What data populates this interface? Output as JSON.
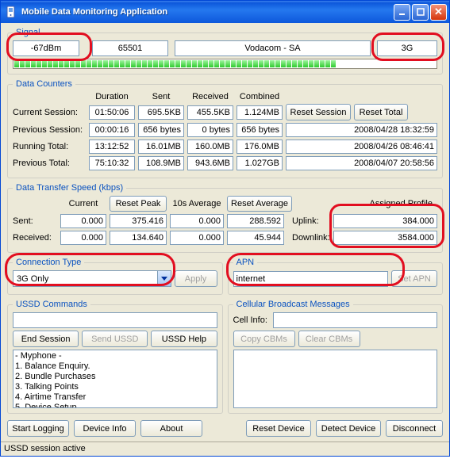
{
  "window": {
    "title": "Mobile Data Monitoring Application"
  },
  "signal": {
    "legend": "Signal",
    "dbm": "-67dBm",
    "code": "65501",
    "operator": "Vodacom - SA",
    "tech": "3G",
    "bars_on": 58,
    "bars_total": 74
  },
  "counters": {
    "legend": "Data Counters",
    "hdr_duration": "Duration",
    "hdr_sent": "Sent",
    "hdr_received": "Received",
    "hdr_combined": "Combined",
    "rows": {
      "current": {
        "label": "Current Session:",
        "dur": "01:50:06",
        "sent": "695.5KB",
        "recv": "455.5KB",
        "comb": "1.124MB"
      },
      "previous": {
        "label": "Previous Session:",
        "dur": "00:00:16",
        "sent": "656 bytes",
        "recv": "0 bytes",
        "comb": "656 bytes",
        "ts": "2008/04/28 18:32:59"
      },
      "running": {
        "label": "Running Total:",
        "dur": "13:12:52",
        "sent": "16.01MB",
        "recv": "160.0MB",
        "comb": "176.0MB",
        "ts": "2008/04/26 08:46:41"
      },
      "prevtot": {
        "label": "Previous Total:",
        "dur": "75:10:32",
        "sent": "108.9MB",
        "recv": "943.6MB",
        "comb": "1.027GB",
        "ts": "2008/04/07 20:58:56"
      }
    },
    "btn_reset_session": "Reset Session",
    "btn_reset_total": "Reset Total"
  },
  "speed": {
    "legend": "Data Transfer Speed (kbps)",
    "hdr_current": "Current",
    "hdr_10s": "10s Average",
    "hdr_profile": "Assigned Profile",
    "btn_reset_peak": "Reset Peak",
    "btn_reset_avg": "Reset Average",
    "sent_label": "Sent:",
    "recv_label": "Received:",
    "sent": {
      "cur": "0.000",
      "peak": "375.416",
      "avg": "0.000",
      "avgpeak": "288.592"
    },
    "recv": {
      "cur": "0.000",
      "peak": "134.640",
      "avg": "0.000",
      "avgpeak": "45.944"
    },
    "uplink_label": "Uplink:",
    "downlink_label": "Downlink:",
    "uplink": "384.000",
    "downlink": "3584.000"
  },
  "conn": {
    "legend": "Connection Type",
    "value": "3G Only",
    "btn_apply": "Apply"
  },
  "apn": {
    "legend": "APN",
    "value": "internet",
    "btn_set": "Set APN"
  },
  "ussd": {
    "legend": "USSD Commands",
    "input": "",
    "btn_end": "End Session",
    "btn_send": "Send USSD",
    "btn_help": "USSD Help",
    "list": "- Myphone -\n1. Balance Enquiry.\n2. Bundle Purchases\n3. Talking Points\n4. Airtime Transfer\n5. Device Setup"
  },
  "cbm": {
    "legend": "Cellular Broadcast Messages",
    "cellinfo_label": "Cell Info:",
    "cellinfo": "",
    "btn_copy": "Copy CBMs",
    "btn_clear": "Clear CBMs"
  },
  "bottom": {
    "start_log": "Start Logging",
    "device_info": "Device Info",
    "about": "About",
    "reset_device": "Reset Device",
    "detect_device": "Detect Device",
    "disconnect": "Disconnect"
  },
  "status": "USSD session active"
}
